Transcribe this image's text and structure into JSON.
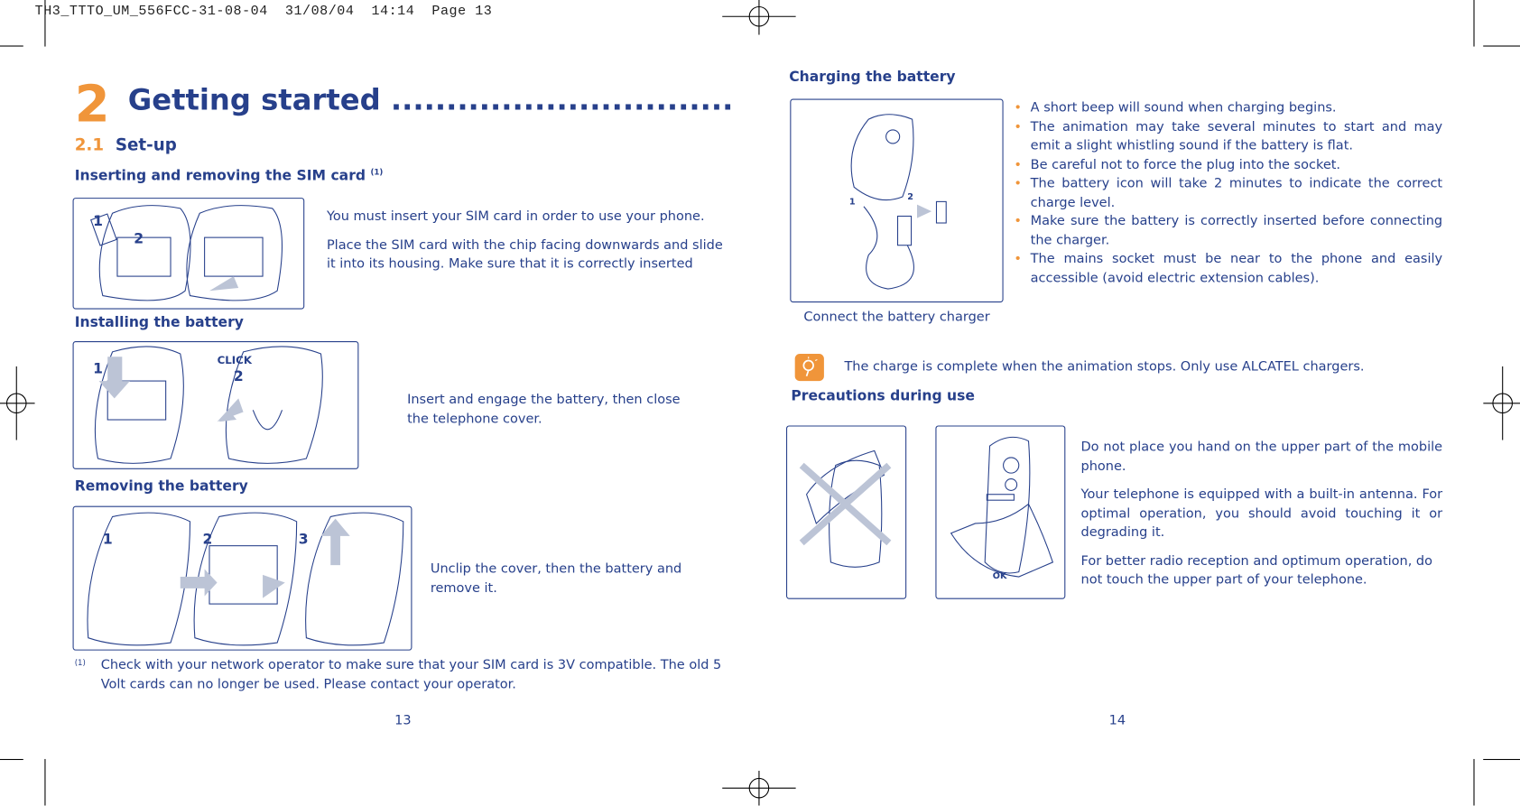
{
  "slug": "TH3_TTTO_UM_556FCC-31-08-04  31/08/04  14:14  Page 13",
  "left_page": {
    "chapter_number": "2",
    "chapter_title": "Getting started ............................................",
    "section_number": "2.1",
    "section_title": "Set-up",
    "sim": {
      "heading": "Inserting and removing the SIM card",
      "footnote_ref": "(1)",
      "step_labels": [
        "1",
        "2"
      ],
      "paragraphs": [
        "You must insert your SIM card in order to use your phone.",
        "Place the SIM card with the chip facing downwards and slide it into its housing. Make sure that it is correctly inserted"
      ]
    },
    "install": {
      "heading": "Installing the battery",
      "step_labels": [
        "1",
        "2"
      ],
      "click_label": "CLICK",
      "text": "Insert and engage the battery, then close the telephone cover."
    },
    "remove": {
      "heading": "Removing the battery",
      "step_labels": [
        "1",
        "2",
        "3"
      ],
      "text": "Unclip the cover, then the battery and remove it."
    },
    "footnote": {
      "marker": "(1)",
      "text": "Check with your network operator to make sure that your SIM card is 3V compatible. The old 5 Volt cards can no longer be used. Please contact your operator."
    },
    "page_number": "13"
  },
  "right_page": {
    "charging": {
      "heading": "Charging the battery",
      "step_labels": [
        "1",
        "2"
      ],
      "caption": "Connect the battery charger",
      "bullets": [
        "A short beep will sound when charging begins.",
        "The animation may take several minutes to start and may emit a slight whistling sound if the battery is flat.",
        "Be careful not to force the plug into the socket.",
        "The battery icon will take 2 minutes to indicate the correct charge level.",
        "Make sure the battery is correctly inserted before connecting the charger.",
        "The mains socket must be near to the phone and easily accessible (avoid electric extension cables)."
      ]
    },
    "tip": {
      "icon": "lightbulb-icon",
      "text": "The charge is complete when the animation stops. Only use ALCATEL chargers."
    },
    "precautions": {
      "heading": "Precautions during use",
      "ok_label": "OK",
      "paragraphs": [
        "Do not place you hand on the upper part of the mobile phone.",
        "Your telephone is equipped with a built-in antenna. For optimal operation, you should avoid touching it or degrading it.",
        "For better radio reception and optimum operation, do not touch the upper part of your telephone."
      ]
    },
    "page_number": "14"
  },
  "colors": {
    "text": "#27408b",
    "accent": "#f0953a"
  }
}
